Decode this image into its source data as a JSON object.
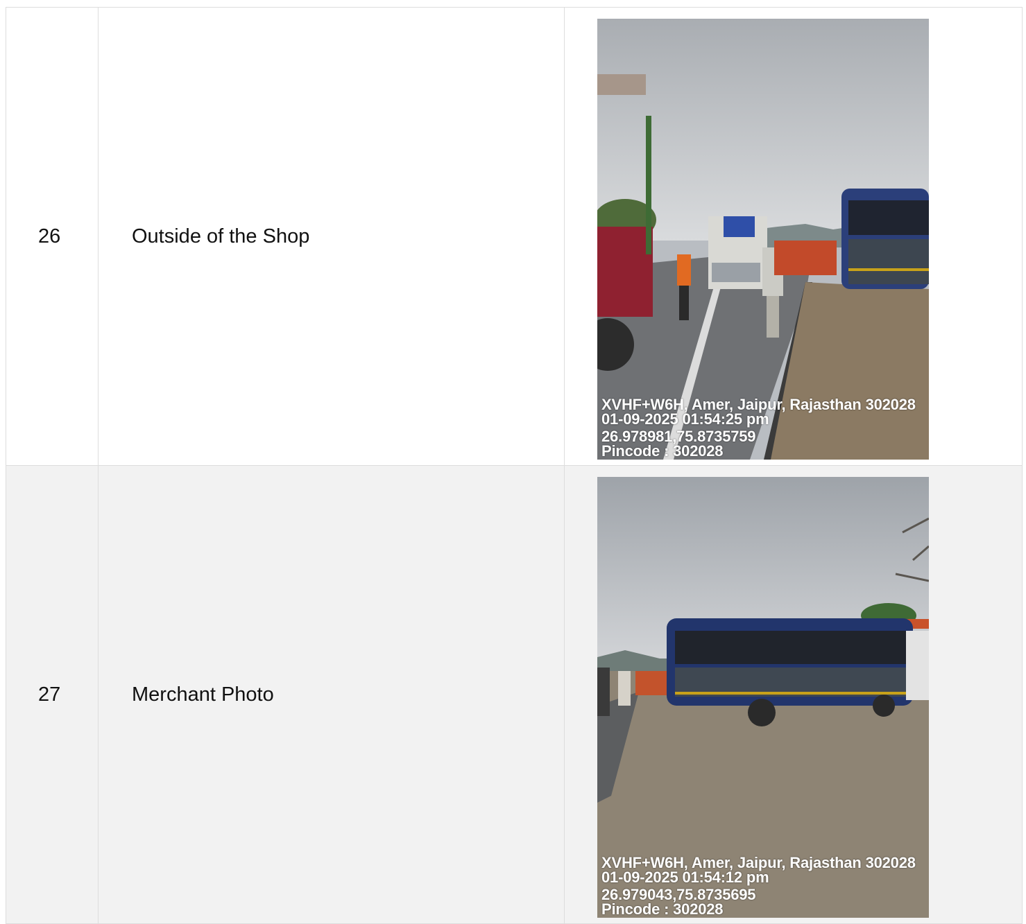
{
  "rows": [
    {
      "number": "26",
      "label": "Outside of the Shop",
      "stamp": {
        "address": "XVHF+W6H, Amer, Jaipur, Rajasthan 302028",
        "datetime": "01-09-2025 01:54:25 pm",
        "coords": "26.978981,75.8735759",
        "pincode": "Pincode : 302028"
      }
    },
    {
      "number": "27",
      "label": "Merchant Photo",
      "stamp": {
        "address": "XVHF+W6H, Amer, Jaipur, Rajasthan 302028",
        "datetime": "01-09-2025 01:54:12 pm",
        "coords": "26.979043,75.8735695",
        "pincode": "Pincode : 302028"
      }
    }
  ]
}
